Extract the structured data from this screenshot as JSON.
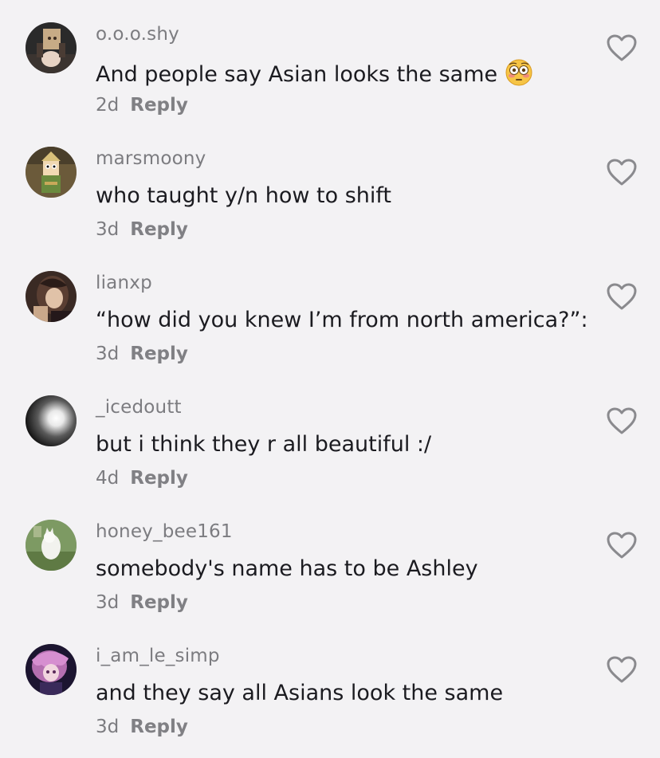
{
  "comments": [
    {
      "username": "o.o.o.shy",
      "text": "And people say Asian looks the same",
      "emoji": "flushed-face-emoji",
      "time": "2d",
      "reply": "Reply"
    },
    {
      "username": "marsmoony",
      "text": "who taught y/n how to shift",
      "time": "3d",
      "reply": "Reply"
    },
    {
      "username": "lianxp",
      "text": "“how did you knew I’m from north america?”:",
      "time": "3d",
      "reply": "Reply"
    },
    {
      "username": "_icedoutt",
      "text": "but i think they r all beautiful :/",
      "time": "4d",
      "reply": "Reply"
    },
    {
      "username": "honey_bee161",
      "text": "somebody's name has to be Ashley",
      "time": "3d",
      "reply": "Reply"
    },
    {
      "username": "i_am_le_simp",
      "text": "and they say all Asians look the same",
      "time": "3d",
      "reply": "Reply"
    }
  ],
  "icons": {
    "like": "heart-outline-icon",
    "avatar": "avatar-image"
  },
  "colors": {
    "background": "#f3f2f4",
    "username": "#7c7c80",
    "text": "#1b1b20",
    "heart": "#8a8a8e"
  }
}
